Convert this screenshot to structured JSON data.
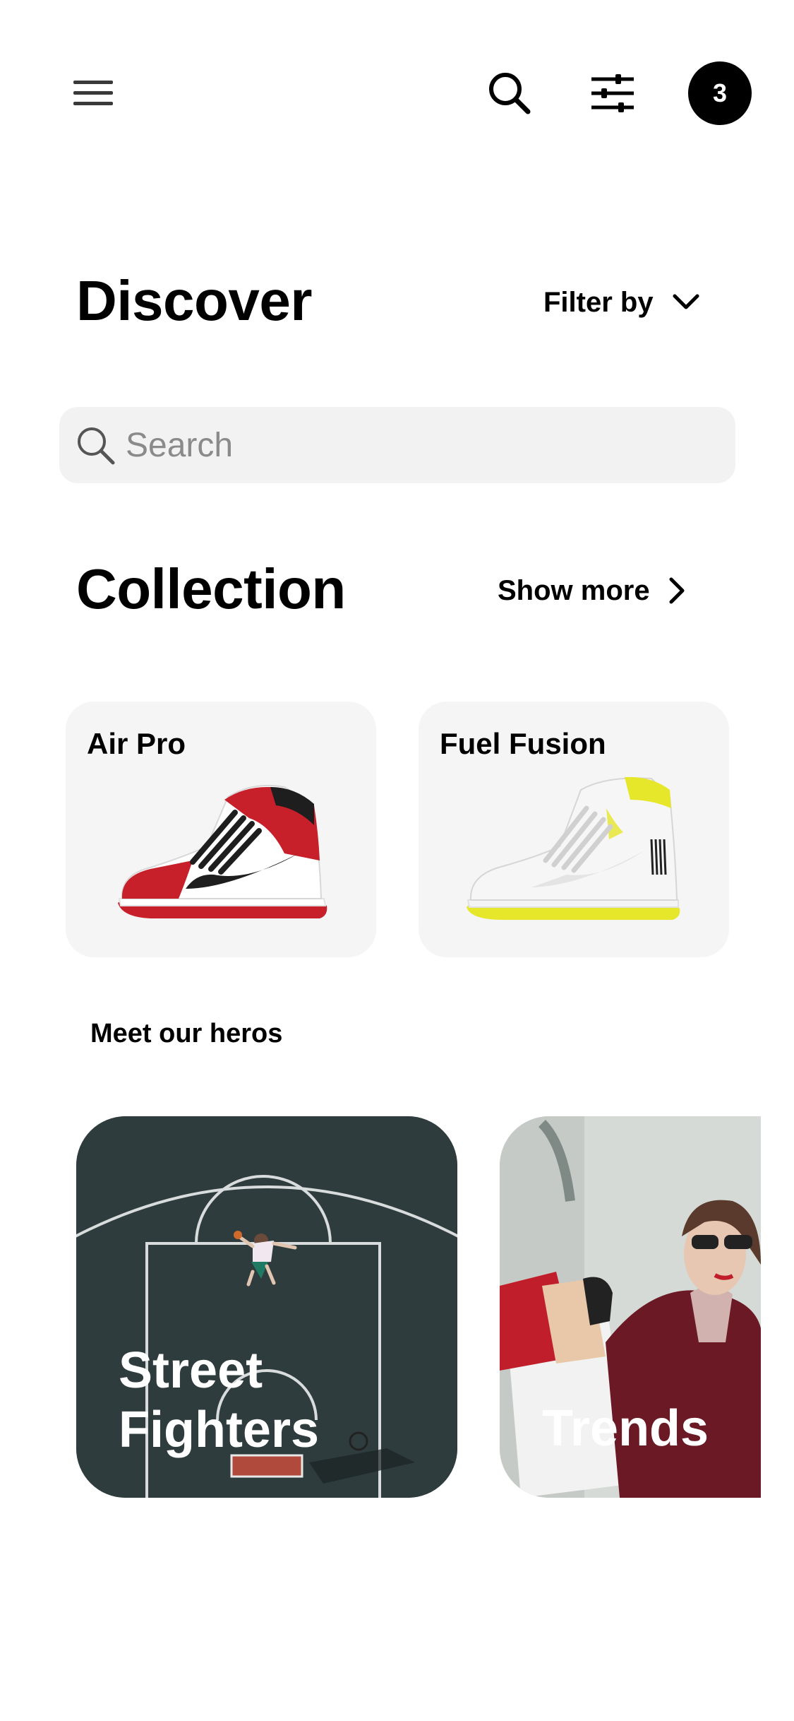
{
  "header": {
    "cart_count": "3",
    "icons": [
      "hamburger-menu-icon",
      "search-icon",
      "sliders-icon"
    ]
  },
  "discover": {
    "title": "Discover",
    "filter_label": "Filter by"
  },
  "search": {
    "placeholder": "Search"
  },
  "collection": {
    "title": "Collection",
    "show_more_label": "Show more",
    "items": [
      {
        "name": "Air Pro",
        "accent": "#c8202a"
      },
      {
        "name": "Fuel Fusion",
        "accent": "#e6e62a"
      }
    ]
  },
  "heroes": {
    "section_label": "Meet our heros",
    "items": [
      {
        "title_line1": "Street",
        "title_line2": "Fighters"
      },
      {
        "title": "Trends"
      }
    ]
  }
}
